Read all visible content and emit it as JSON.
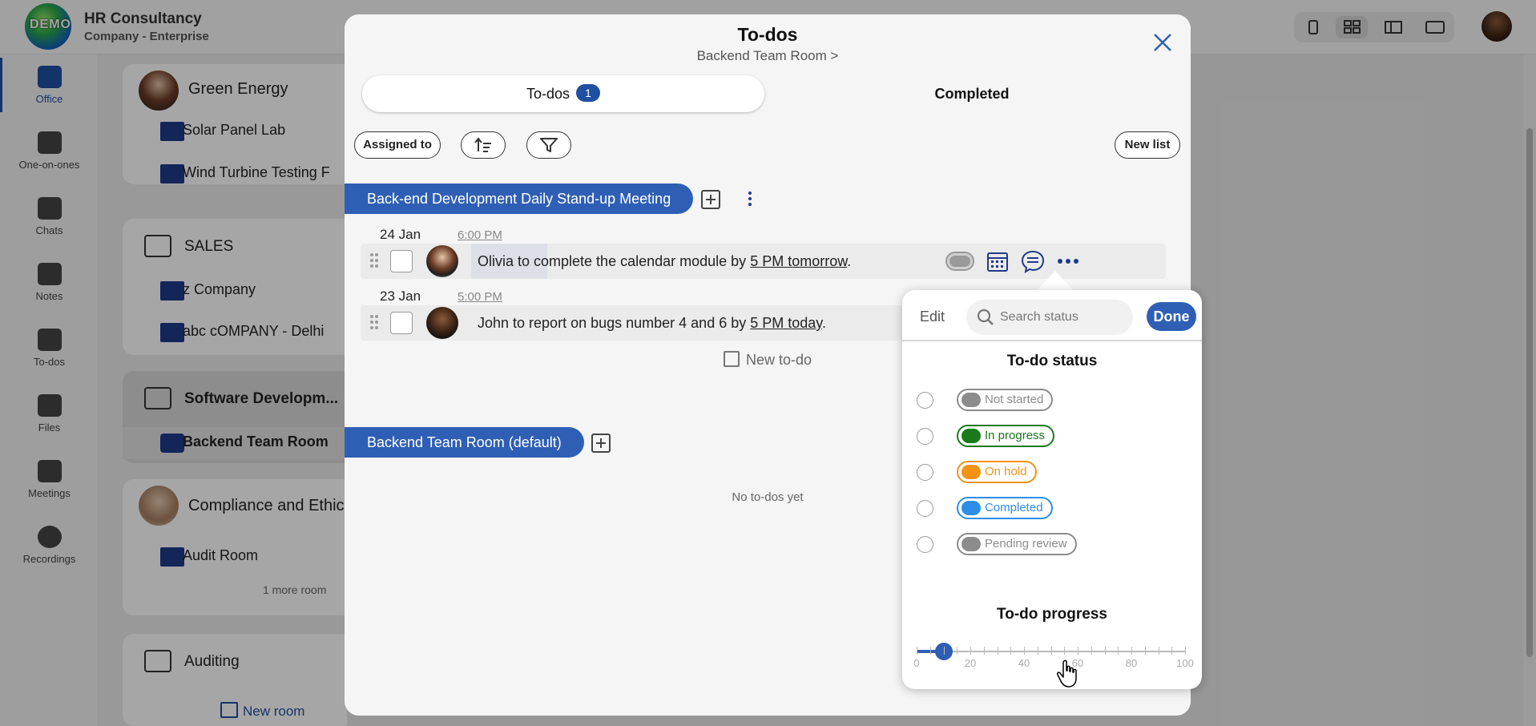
{
  "header": {
    "company_name": "HR Consultancy",
    "company_plan": "Company - Enterprise",
    "logo_text": "DEMO"
  },
  "nav": {
    "items": [
      {
        "label": "Office",
        "icon": "briefcase-icon",
        "active": true
      },
      {
        "label": "One-on-ones",
        "icon": "people-icon"
      },
      {
        "label": "Chats",
        "icon": "chat-icon"
      },
      {
        "label": "Notes",
        "icon": "notes-icon"
      },
      {
        "label": "To-dos",
        "icon": "checklist-icon"
      },
      {
        "label": "Files",
        "icon": "files-icon"
      },
      {
        "label": "Meetings",
        "icon": "meetings-icon"
      },
      {
        "label": "Recordings",
        "icon": "recordings-icon"
      }
    ]
  },
  "rooms": {
    "groups": [
      {
        "name": "Green Energy",
        "rooms": [
          "Solar Panel Lab",
          "Wind Turbine Testing F"
        ]
      },
      {
        "name": "SALES",
        "rooms": [
          "z Company",
          "abc cOMPANY - Delhi"
        ]
      },
      {
        "name": "Software Developm...",
        "rooms": [
          "Backend Team Room"
        ]
      },
      {
        "name": "Compliance and Ethics",
        "rooms": [
          "Audit Room"
        ],
        "more": "1 more room"
      },
      {
        "name": "Auditing",
        "rooms": []
      }
    ],
    "new_room_label": "New room"
  },
  "modal": {
    "title": "To-dos",
    "subtitle": "Backend Team Room >",
    "tabs": [
      {
        "label": "To-dos",
        "badge": "1",
        "active": true
      },
      {
        "label": "Completed"
      }
    ],
    "toolbar": {
      "assigned_to": "Assigned to",
      "new_list": "New list"
    },
    "lists": [
      {
        "title": "Back-end Development Daily Stand-up Meeting",
        "todos": [
          {
            "date": "24 Jan",
            "time": "6:00 PM",
            "text_before": "Olivia to complete the calendar module by ",
            "link": "5 PM tomorrow",
            "text_after": "."
          },
          {
            "date": "23 Jan",
            "time": "5:00 PM",
            "text_before": "John to report on bugs number 4 and 6 by ",
            "link": "5 PM today",
            "text_after": "."
          }
        ],
        "new_todo": "New to-do"
      },
      {
        "title": "Backend Team Room (default)",
        "empty_text": "No to-dos yet"
      }
    ]
  },
  "status_popover": {
    "edit_label": "Edit",
    "search_placeholder": "Search status",
    "done_label": "Done",
    "status_title": "To-do status",
    "statuses": [
      {
        "label": "Not started",
        "color": "#8c8c8c"
      },
      {
        "label": "In progress",
        "color": "#1a7a1a"
      },
      {
        "label": "On hold",
        "color": "#f39214"
      },
      {
        "label": "Completed",
        "color": "#2d8ee8"
      },
      {
        "label": "Pending review",
        "color": "#8c8c8c"
      }
    ],
    "progress_title": "To-do progress",
    "progress_value": 10,
    "progress_ticks": [
      "0",
      "20",
      "40",
      "60",
      "80",
      "100"
    ]
  },
  "colors": {
    "accent": "#2f5fb4",
    "brand_dark": "#1f3a8a"
  }
}
